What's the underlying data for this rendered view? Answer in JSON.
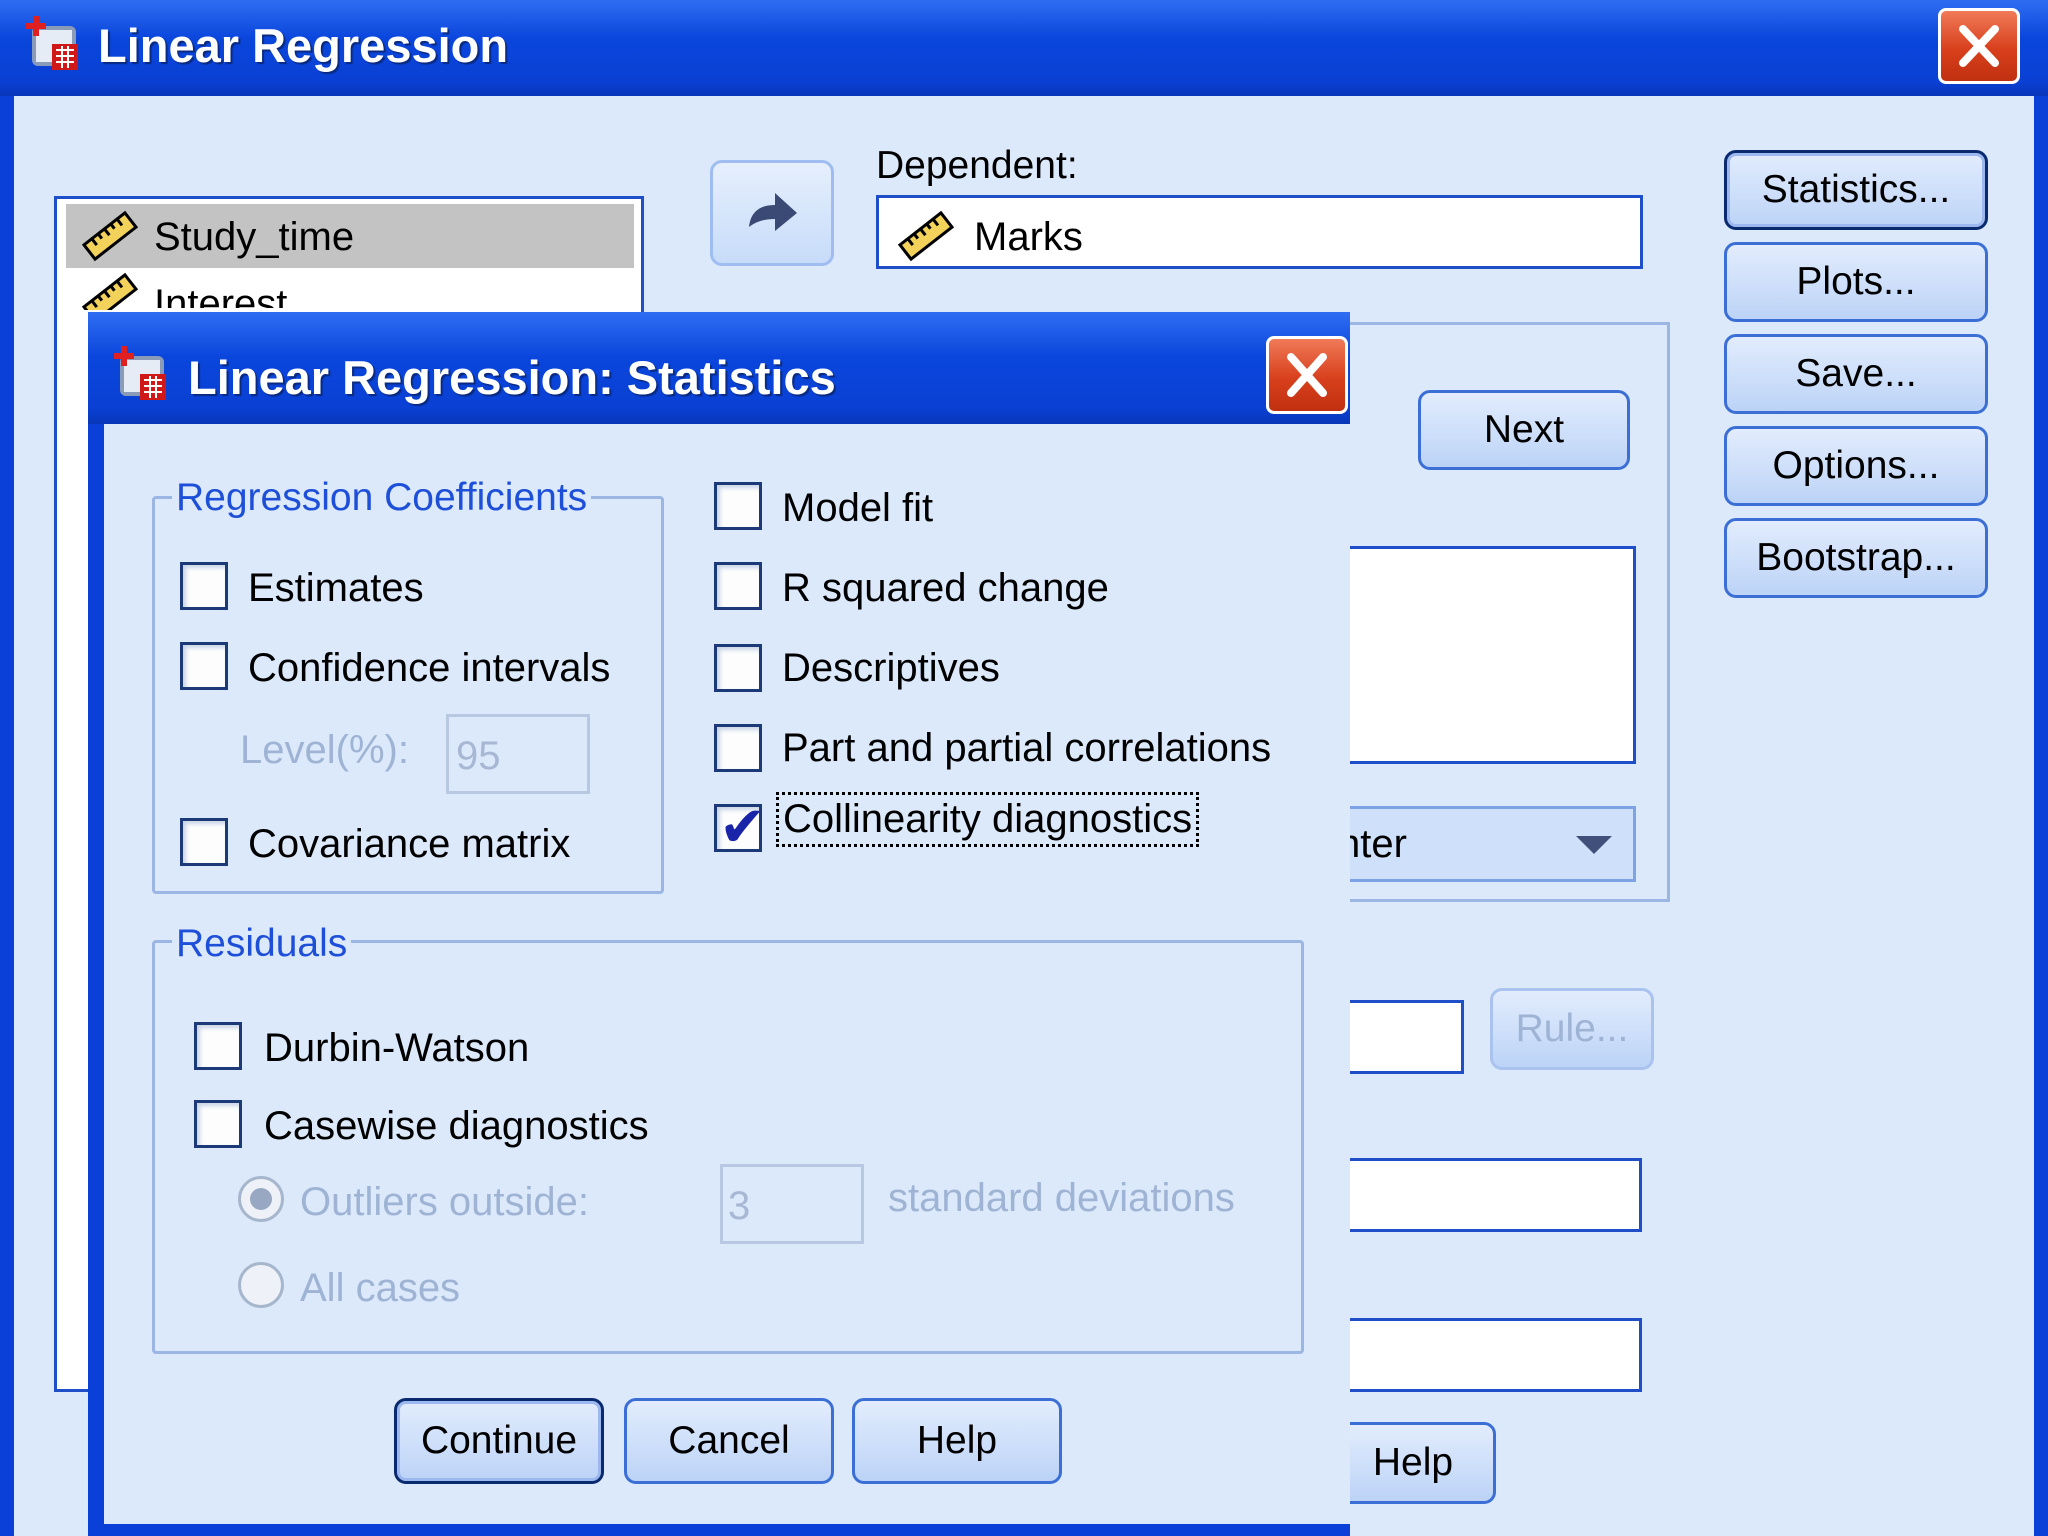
{
  "main_window": {
    "title": "Linear Regression",
    "variables": [
      "Study_time",
      "Interest"
    ],
    "dependent_label": "Dependent:",
    "dependent_value": "Marks",
    "method_partial": "nter",
    "buttons": {
      "statistics": "Statistics...",
      "plots": "Plots...",
      "save": "Save...",
      "options": "Options...",
      "bootstrap": "Bootstrap...",
      "next": "Next",
      "rule": "Rule...",
      "help": "Help"
    }
  },
  "stats_dialog": {
    "title": "Linear Regression: Statistics",
    "regression_coefficients": {
      "legend": "Regression Coefficients",
      "estimates": {
        "label": "Estimates",
        "checked": false
      },
      "confidence_intervals": {
        "label": "Confidence intervals",
        "checked": false
      },
      "level_label": "Level(%):",
      "level_value": "95",
      "covariance_matrix": {
        "label": "Covariance matrix",
        "checked": false
      }
    },
    "model_fit": {
      "label": "Model fit",
      "checked": false
    },
    "r_squared_change": {
      "label": "R squared change",
      "checked": false
    },
    "descriptives": {
      "label": "Descriptives",
      "checked": false
    },
    "part_partial": {
      "label": "Part and partial correlations",
      "checked": false
    },
    "collinearity": {
      "label": "Collinearity diagnostics",
      "checked": true
    },
    "residuals": {
      "legend": "Residuals",
      "durbin_watson": {
        "label": "Durbin-Watson",
        "checked": false
      },
      "casewise": {
        "label": "Casewise diagnostics",
        "checked": false
      },
      "outliers_label": "Outliers outside:",
      "outliers_value": "3",
      "std_dev_label": "standard deviations",
      "all_cases_label": "All cases"
    },
    "buttons": {
      "continue": "Continue",
      "cancel": "Cancel",
      "help": "Help"
    },
    "check_glyph": "✔",
    "colors": {
      "titlebar": "#0a40d4",
      "body": "#dce9fb",
      "legend_text": "#1e4fd8",
      "close": "#d8401c"
    }
  }
}
